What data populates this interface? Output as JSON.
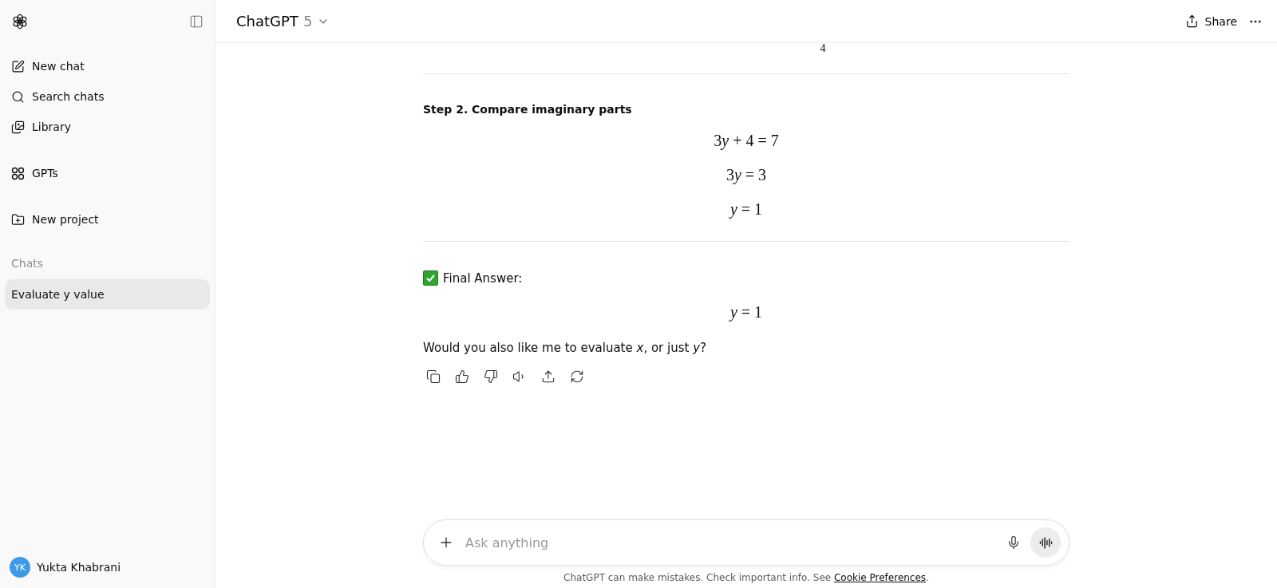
{
  "sidebar": {
    "nav": [
      {
        "kind": "edit",
        "label": "New chat"
      },
      {
        "kind": "search",
        "label": "Search chats"
      },
      {
        "kind": "library",
        "label": "Library"
      },
      {
        "kind": "gpts",
        "label": "GPTs"
      },
      {
        "kind": "project",
        "label": "New project"
      }
    ],
    "section_label": "Chats",
    "chats": [
      {
        "label": "Evaluate y value",
        "selected": true
      }
    ],
    "user": {
      "initials": "YK",
      "name": "Yukta Khabrani"
    }
  },
  "header": {
    "title": "ChatGPT",
    "version": "5",
    "share": "Share"
  },
  "message": {
    "cut_denominator": "4",
    "step_heading": "Step 2. Compare imaginary parts",
    "equations": [
      {
        "prefix": "3",
        "var": "y",
        "suffix": " + 4 = 7"
      },
      {
        "prefix": "3",
        "var": "y",
        "suffix": " = 3"
      },
      {
        "var": "y",
        "suffix": " = 1"
      }
    ],
    "final_label": "Final Answer:",
    "final_equation": "*y* = 1",
    "question": "Would you also like me to evaluate *x*, or just *y*?"
  },
  "composer": {
    "placeholder": "Ask anything"
  },
  "footer": {
    "text": "ChatGPT can make mistakes. Check important info. See ",
    "link": "Cookie Preferences",
    "end": "."
  }
}
